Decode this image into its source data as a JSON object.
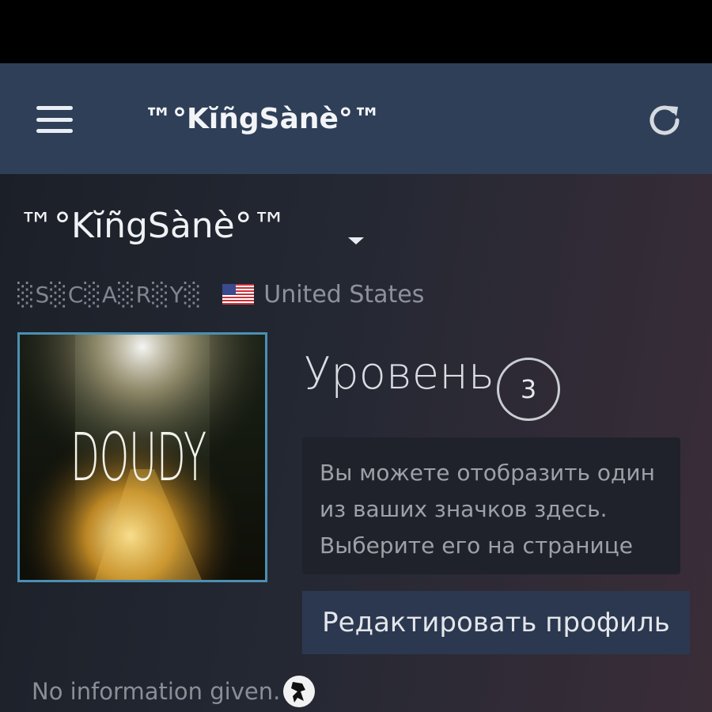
{
  "header": {
    "title": "™°KĭñgSànè°™",
    "menu_icon": "hamburger-menu-icon",
    "refresh_icon": "refresh-icon"
  },
  "profile": {
    "name": "™°KĭñgSànè°™",
    "tag": "░S░C░A░R░Y░",
    "country": "United States",
    "avatar_text": "DOUDY",
    "level_label": "Уровень",
    "level": "3",
    "badge_lines": [
      "Вы можете отобразить один",
      "из ваших значков здесь.",
      "Выберите его на странице"
    ],
    "edit_button": "Редактировать профиль",
    "summary": "No information given."
  },
  "colors": {
    "header_bg": "#2f3f58",
    "avatar_border": "#4c8fb3",
    "button_bg": "#2c3850"
  }
}
